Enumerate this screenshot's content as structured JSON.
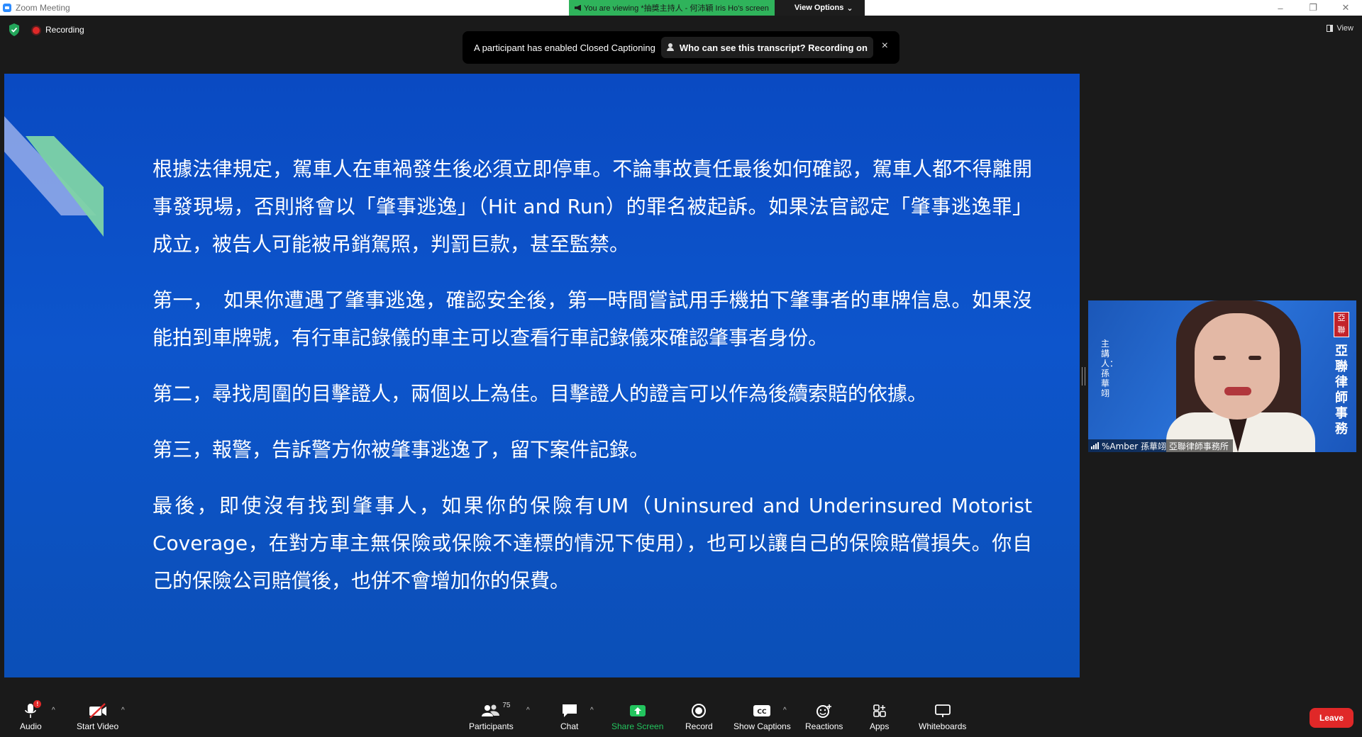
{
  "window": {
    "title": "Zoom Meeting",
    "controls": [
      "–",
      "❐",
      "✕"
    ]
  },
  "share_banner": {
    "viewing_text": "You are viewing *抽獎主持人 - 何沛穎 Iris Ho's screen",
    "view_options": "View Options"
  },
  "topbar": {
    "recording_label": "Recording",
    "view_label": "View"
  },
  "cc_notification": {
    "message": "A participant has enabled Closed Captioning",
    "who_link": "Who can see this transcript? Recording on",
    "close": "×"
  },
  "slide": {
    "paragraphs": [
      "根據法律規定，駕車人在車禍發生後必須立即停車。不論事故責任最後如何確認，駕車人都不得離開事發現場，否則將會以「肇事逃逸」（Hit and Run）的罪名被起訴。如果法官認定「肇事逃逸罪」成立，被告人可能被吊銷駕照，判罰巨款，甚至監禁。",
      "第一，　如果你遭遇了肇事逃逸，確認安全後，第一時間嘗試用手機拍下肇事者的車牌信息。如果沒能拍到車牌號，有行車記錄儀的車主可以查看行車記錄儀來確認肇事者身份。",
      "第二，尋找周圍的目擊證人，兩個以上為佳。目擊證人的證言可以作為後續索賠的依據。",
      "第三，報警，告訴警方你被肇事逃逸了，留下案件記錄。",
      "最後，即使沒有找到肇事人，如果你的保險有UM（Uninsured and Underinsured Motorist Coverage，在對方車主無保險或保險不達標的情況下使用），也可以讓自己的保險賠償損失。你自己的保險公司賠償後，也併不會增加你的保費。"
    ]
  },
  "video_tile": {
    "name": "%Amber 孫華翊 亞聯律師事務所",
    "speaker_side_text": "主講人：孫華翊",
    "firm_side_text": "亞聯律師事務",
    "seal_text": "亞聯"
  },
  "toolbar": {
    "audio": "Audio",
    "start_video": "Start Video",
    "participants": "Participants",
    "participants_count": "75",
    "chat": "Chat",
    "share_screen": "Share Screen",
    "record": "Record",
    "show_captions": "Show Captions",
    "reactions": "Reactions",
    "apps": "Apps",
    "whiteboards": "Whiteboards",
    "leave": "Leave",
    "audio_badge": "!"
  },
  "colors": {
    "slide_blue": "#0a4ac2",
    "share_green": "#2fb35b",
    "leave_red": "#e02828",
    "recording_red": "#e02828"
  }
}
